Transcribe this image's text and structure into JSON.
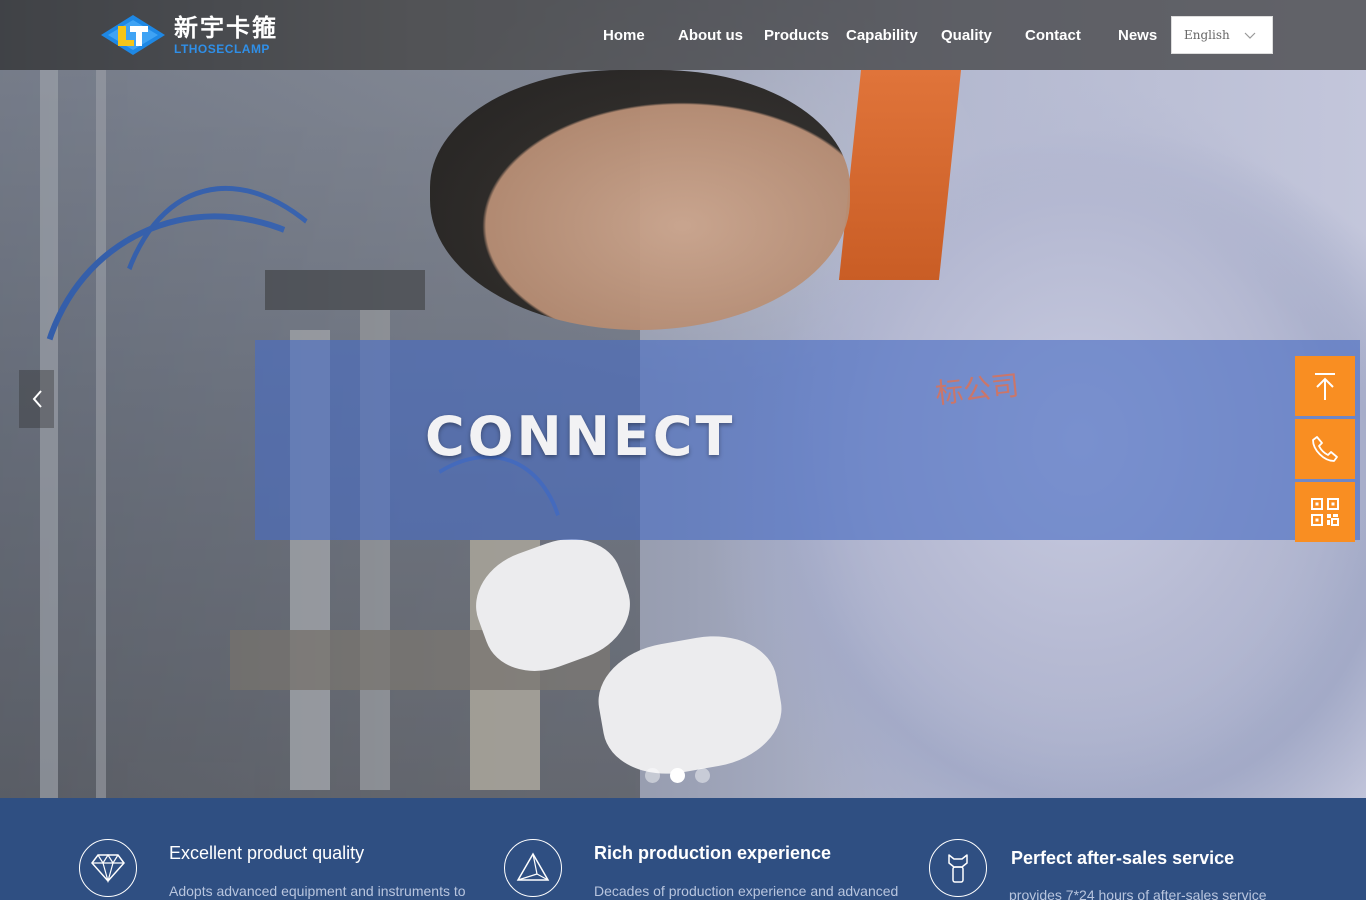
{
  "header": {
    "logo": {
      "cn": "新宇卡箍",
      "en": "LTHOSECLAMP"
    },
    "nav": [
      {
        "label": "Home"
      },
      {
        "label": "About us"
      },
      {
        "label": "Products"
      },
      {
        "label": "Capability"
      },
      {
        "label": "Quality"
      },
      {
        "label": "Contact"
      },
      {
        "label": "News"
      }
    ],
    "language": {
      "selected": "English"
    }
  },
  "hero": {
    "title": "CONNECT",
    "stamp_text": "标公司",
    "carousel": {
      "slides": 3,
      "active": 2
    }
  },
  "side_buttons": [
    {
      "icon": "arrow-up-icon"
    },
    {
      "icon": "phone-icon"
    },
    {
      "icon": "qr-code-icon"
    }
  ],
  "features": [
    {
      "icon": "diamond-icon",
      "title": "Excellent product quality",
      "desc": "Adopts advanced equipment and instruments to"
    },
    {
      "icon": "pyramid-icon",
      "title": "Rich production  experience",
      "desc": "Decades of production experience and advanced"
    },
    {
      "icon": "wrench-icon",
      "title": "Perfect after-sales service",
      "desc": "provides 7*24 hours of after-sales service"
    }
  ],
  "colors": {
    "accent_orange": "#f98e22",
    "feature_bar": "#2f4f82",
    "banner_band": "#486cc4",
    "logo_blue": "#2f8fe8",
    "logo_yellow": "#f5c518"
  }
}
